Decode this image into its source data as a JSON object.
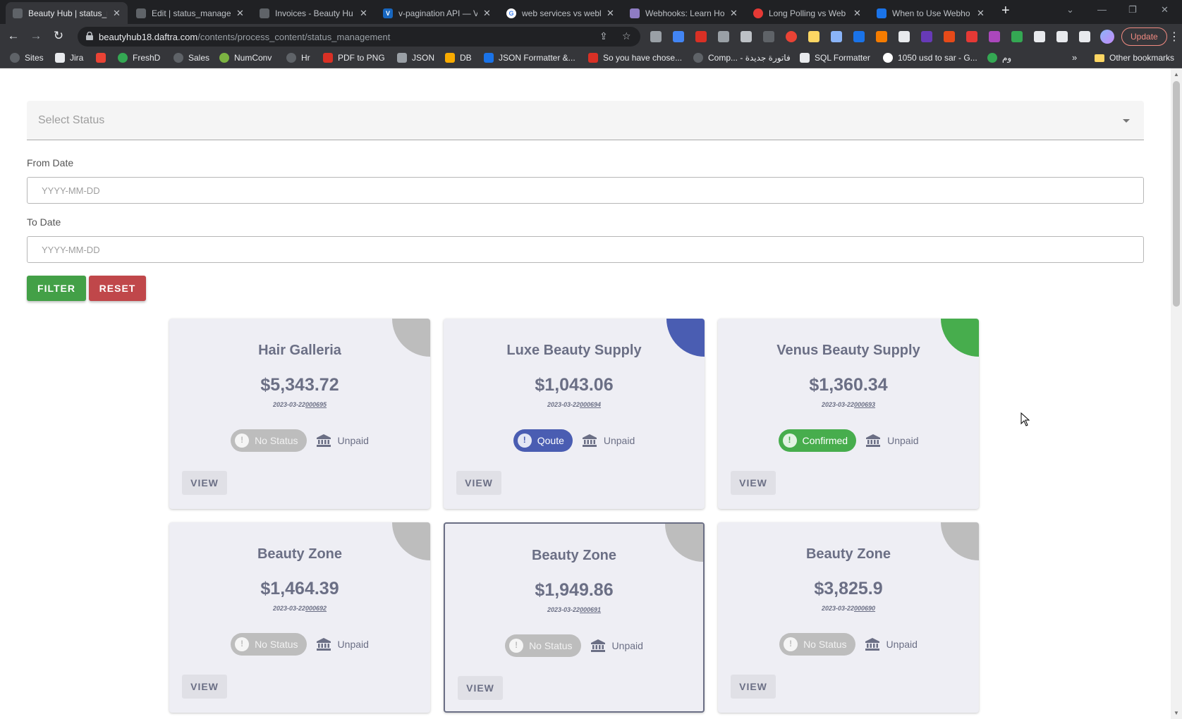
{
  "browser": {
    "tabs": [
      {
        "label": "Beauty Hub | status_r",
        "favicon_color": "#5f6368"
      },
      {
        "label": "Edit | status_manage",
        "favicon_color": "#5f6368"
      },
      {
        "label": "Invoices - Beauty Hu",
        "favicon_color": "#5f6368"
      },
      {
        "label": "v-pagination API — V",
        "favicon_color": "#1867c0"
      },
      {
        "label": "web services vs webl",
        "favicon_color": "#4285f4"
      },
      {
        "label": "Webhooks: Learn Ho",
        "favicon_color": "#8e7cc3"
      },
      {
        "label": "Long Polling vs Web",
        "favicon_color": "#e53935"
      },
      {
        "label": "When to Use Webho",
        "favicon_color": "#1a73e8"
      }
    ],
    "url_host": "beautyhub18.daftra.com",
    "url_path": "/contents/process_content/status_management",
    "update_label": "Update",
    "bookmarks": [
      {
        "label": "Sites",
        "color": "#5f6368"
      },
      {
        "label": "Jira",
        "color": "#e8eaed"
      },
      {
        "label": "",
        "color": "#ea4335"
      },
      {
        "label": "FreshD",
        "color": "#34a853"
      },
      {
        "label": "Sales",
        "color": "#5f6368"
      },
      {
        "label": "NumConv",
        "color": "#7cb342"
      },
      {
        "label": "Hr",
        "color": "#5f6368"
      },
      {
        "label": "PDF to PNG",
        "color": "#d93025"
      },
      {
        "label": "JSON",
        "color": "#9aa0a6"
      },
      {
        "label": "DB",
        "color": "#f9ab00"
      },
      {
        "label": "JSON Formatter &...",
        "color": "#1a73e8"
      },
      {
        "label": "So you have chose...",
        "color": "#d93025"
      },
      {
        "label": "Comp... - فاتورة جديدة",
        "color": "#5f6368"
      },
      {
        "label": "SQL Formatter",
        "color": "#e8eaed"
      },
      {
        "label": "1050 usd to sar - G...",
        "color": "#4285f4"
      },
      {
        "label": "وم",
        "color": "#34a853"
      }
    ],
    "other_bookmarks": "Other bookmarks"
  },
  "filters": {
    "status_placeholder": "Select Status",
    "from_label": "From Date",
    "from_placeholder": "YYYY-MM-DD",
    "to_label": "To Date",
    "to_placeholder": "YYYY-MM-DD",
    "filter_label": "FILTER",
    "reset_label": "RESET"
  },
  "cards": [
    {
      "name": "Hair Galleria",
      "amount": "$5,343.72",
      "date": "2023-03-22",
      "number": "000695",
      "status": "No Status",
      "status_type": "none",
      "corner_color": "#bdbdbd",
      "payment": "Unpaid",
      "view": "VIEW"
    },
    {
      "name": "Luxe Beauty Supply",
      "amount": "$1,043.06",
      "date": "2023-03-22",
      "number": "000694",
      "status": "Qoute",
      "status_type": "quote",
      "corner_color": "#4a5db2",
      "payment": "Unpaid",
      "view": "VIEW"
    },
    {
      "name": "Venus Beauty Supply",
      "amount": "$1,360.34",
      "date": "2023-03-22",
      "number": "000693",
      "status": "Confirmed",
      "status_type": "confirmed",
      "corner_color": "#47ad4d",
      "payment": "Unpaid",
      "view": "VIEW"
    },
    {
      "name": "Beauty Zone",
      "amount": "$1,464.39",
      "date": "2023-03-22",
      "number": "000692",
      "status": "No Status",
      "status_type": "none",
      "corner_color": "#bdbdbd",
      "payment": "Unpaid",
      "view": "VIEW"
    },
    {
      "name": "Beauty Zone",
      "amount": "$1,949.86",
      "date": "2023-03-22",
      "number": "000691",
      "status": "No Status",
      "status_type": "none",
      "corner_color": "#bdbdbd",
      "payment": "Unpaid",
      "view": "VIEW"
    },
    {
      "name": "Beauty Zone",
      "amount": "$3,825.9",
      "date": "2023-03-22",
      "number": "000690",
      "status": "No Status",
      "status_type": "none",
      "corner_color": "#bdbdbd",
      "payment": "Unpaid",
      "view": "VIEW"
    }
  ]
}
